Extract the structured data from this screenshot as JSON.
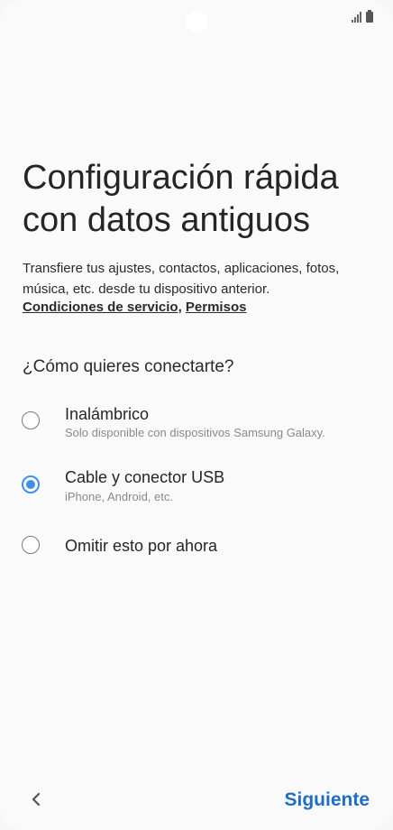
{
  "status_bar": {
    "icons": [
      "signal-icon",
      "battery-icon"
    ]
  },
  "title": "Configuración rápida con datos antiguos",
  "description": "Transfiere tus ajustes, contactos, aplicaciones, fotos, música, etc. desde tu dispositivo anterior.",
  "links": {
    "terms": "Condiciones de servicio",
    "separator": ",",
    "permissions": "Permisos"
  },
  "question": "¿Cómo quieres conectarte?",
  "options": [
    {
      "label": "Inalámbrico",
      "sub": "Solo disponible con dispositivos Samsung Galaxy.",
      "selected": false
    },
    {
      "label": "Cable y conector USB",
      "sub": "iPhone, Android, etc.",
      "selected": true
    },
    {
      "label": "Omitir esto por ahora",
      "sub": "",
      "selected": false
    }
  ],
  "footer": {
    "back_icon": "chevron-left-icon",
    "next_label": "Siguiente"
  },
  "colors": {
    "accent": "#3e91ea",
    "next_button": "#1f6dc5"
  }
}
